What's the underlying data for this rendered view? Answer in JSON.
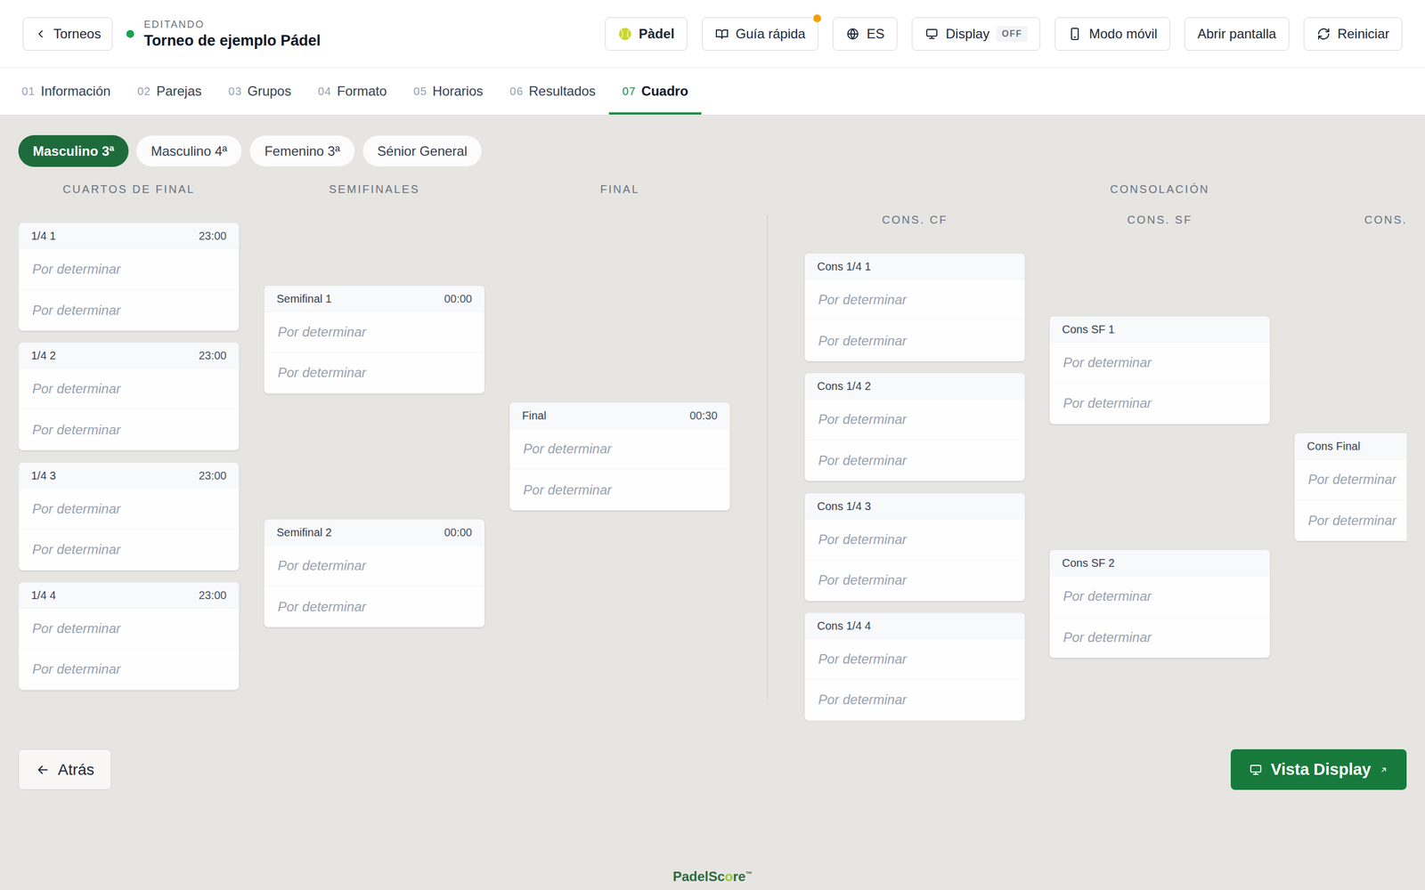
{
  "header": {
    "back": "Torneos",
    "status_label": "EDITANDO",
    "title": "Torneo de ejemplo Pádel",
    "buttons": [
      {
        "label": "Pàdel",
        "kind": "sport",
        "badge": "",
        "notification": false
      },
      {
        "label": "Guía rápida",
        "kind": "guide",
        "badge": "",
        "notification": true
      },
      {
        "label": "ES",
        "kind": "language",
        "badge": "",
        "notification": false
      },
      {
        "label": "Display",
        "kind": "display",
        "badge": "OFF",
        "notification": false
      },
      {
        "label": "Modo móvil",
        "kind": "mobile",
        "badge": "",
        "notification": false
      },
      {
        "label": "Abrir pantalla",
        "kind": "text",
        "badge": "",
        "notification": false
      },
      {
        "label": "Reiniciar",
        "kind": "reset",
        "badge": "",
        "notification": false
      }
    ]
  },
  "tabs": [
    {
      "num": "01",
      "label": "Información",
      "selected": false
    },
    {
      "num": "02",
      "label": "Parejas",
      "selected": false
    },
    {
      "num": "03",
      "label": "Grupos",
      "selected": false
    },
    {
      "num": "04",
      "label": "Formato",
      "selected": false
    },
    {
      "num": "05",
      "label": "Horarios",
      "selected": false
    },
    {
      "num": "06",
      "label": "Resultados",
      "selected": false
    },
    {
      "num": "07",
      "label": "Cuadro",
      "selected": true
    }
  ],
  "categories": [
    {
      "label": "Masculino 3ª",
      "selected": true
    },
    {
      "label": "Masculino 4ª",
      "selected": false
    },
    {
      "label": "Femenino 3ª",
      "selected": false
    },
    {
      "label": "Sénior General",
      "selected": false
    }
  ],
  "bracket": {
    "main_rounds": [
      {
        "title": "CUARTOS DE FINAL",
        "matches": [
          {
            "label": "1/4 1",
            "time": "23:00",
            "team1": "Por determinar",
            "team2": "Por determinar"
          },
          {
            "label": "1/4 2",
            "time": "23:00",
            "team1": "Por determinar",
            "team2": "Por determinar"
          },
          {
            "label": "1/4 3",
            "time": "23:00",
            "team1": "Por determinar",
            "team2": "Por determinar"
          },
          {
            "label": "1/4 4",
            "time": "23:00",
            "team1": "Por determinar",
            "team2": "Por determinar"
          }
        ]
      },
      {
        "title": "SEMIFINALES",
        "matches": [
          {
            "label": "Semifinal 1",
            "time": "00:00",
            "team1": "Por determinar",
            "team2": "Por determinar"
          },
          {
            "label": "Semifinal 2",
            "time": "00:00",
            "team1": "Por determinar",
            "team2": "Por determinar"
          }
        ]
      },
      {
        "title": "FINAL",
        "matches": [
          {
            "label": "Final",
            "time": "00:30",
            "team1": "Por determinar",
            "team2": "Por determinar"
          }
        ]
      }
    ],
    "consolation": {
      "title": "CONSOLACIÓN",
      "rounds": [
        {
          "title": "CONS. CF",
          "matches": [
            {
              "label": "Cons 1/4 1",
              "time": "",
              "team1": "Por determinar",
              "team2": "Por determinar"
            },
            {
              "label": "Cons 1/4 2",
              "time": "",
              "team1": "Por determinar",
              "team2": "Por determinar"
            },
            {
              "label": "Cons 1/4 3",
              "time": "",
              "team1": "Por determinar",
              "team2": "Por determinar"
            },
            {
              "label": "Cons 1/4 4",
              "time": "",
              "team1": "Por determinar",
              "team2": "Por determinar"
            }
          ]
        },
        {
          "title": "CONS. SF",
          "matches": [
            {
              "label": "Cons SF 1",
              "time": "",
              "team1": "Por determinar",
              "team2": "Por determinar"
            },
            {
              "label": "Cons SF 2",
              "time": "",
              "team1": "Por determinar",
              "team2": "Por determinar"
            }
          ]
        },
        {
          "title": "CONS.",
          "matches": [
            {
              "label": "Cons Final",
              "time": "",
              "team1": "Por determinar",
              "team2": "Por determinar"
            }
          ]
        }
      ]
    }
  },
  "footer": {
    "back": "Atrás",
    "display": "Vista Display",
    "logo": [
      "PadelSc",
      "o",
      "re",
      "™"
    ]
  }
}
